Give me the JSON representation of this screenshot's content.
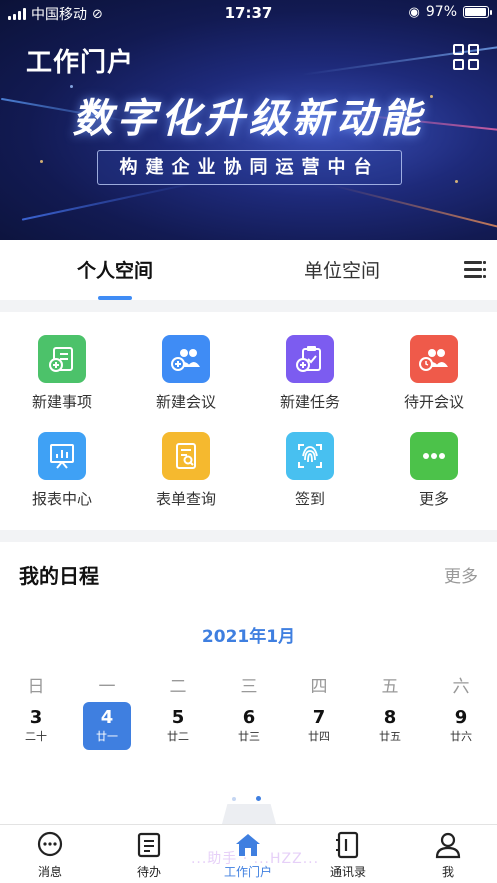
{
  "status_bar": {
    "carrier": "中国移动",
    "time": "17:37",
    "battery": "97%",
    "battery_level": 0.97
  },
  "header": {
    "title": "工作门户",
    "grid_icon": "apps-grid-icon"
  },
  "banner": {
    "slogan": "数字化升级新动能",
    "subtitle": "构建企业协同运营中台"
  },
  "tabs": [
    {
      "label": "个人空间",
      "active": true
    },
    {
      "label": "单位空间",
      "active": false
    }
  ],
  "quick_actions": [
    {
      "label": "新建事项",
      "icon": "new-item-icon",
      "color": "#4cc26a"
    },
    {
      "label": "新建会议",
      "icon": "new-meeting-icon",
      "color": "#3f8cf5"
    },
    {
      "label": "新建任务",
      "icon": "new-task-icon",
      "color": "#7c5cf0"
    },
    {
      "label": "待开会议",
      "icon": "pending-meeting-icon",
      "color": "#ef5a4a"
    },
    {
      "label": "报表中心",
      "icon": "report-icon",
      "color": "#3fa1f5"
    },
    {
      "label": "表单查询",
      "icon": "form-search-icon",
      "color": "#f5b92f"
    },
    {
      "label": "签到",
      "icon": "fingerprint-icon",
      "color": "#48c0f0"
    },
    {
      "label": "更多",
      "icon": "more-icon",
      "color": "#4cc24a"
    }
  ],
  "schedule": {
    "title": "我的日程",
    "more": "更多",
    "month": "2021年1月",
    "weekdays": [
      "日",
      "一",
      "二",
      "三",
      "四",
      "五",
      "六"
    ],
    "days": [
      {
        "num": "3",
        "lunar": "二十",
        "selected": false
      },
      {
        "num": "4",
        "lunar": "廿一",
        "selected": true
      },
      {
        "num": "5",
        "lunar": "廿二",
        "selected": false
      },
      {
        "num": "6",
        "lunar": "廿三",
        "selected": false
      },
      {
        "num": "7",
        "lunar": "廿四",
        "selected": false
      },
      {
        "num": "8",
        "lunar": "廿五",
        "selected": false
      },
      {
        "num": "9",
        "lunar": "廿六",
        "selected": false
      }
    ]
  },
  "bottom_nav": [
    {
      "label": "消息",
      "icon": "message-icon",
      "active": false
    },
    {
      "label": "待办",
      "icon": "todo-icon",
      "active": false
    },
    {
      "label": "工作门户",
      "icon": "home-icon",
      "active": true
    },
    {
      "label": "通讯录",
      "icon": "contacts-icon",
      "active": false
    },
    {
      "label": "我",
      "icon": "profile-icon",
      "active": false
    }
  ],
  "watermark": "...助手 · ...HZZ...",
  "accent_color": "#3f7fe0"
}
